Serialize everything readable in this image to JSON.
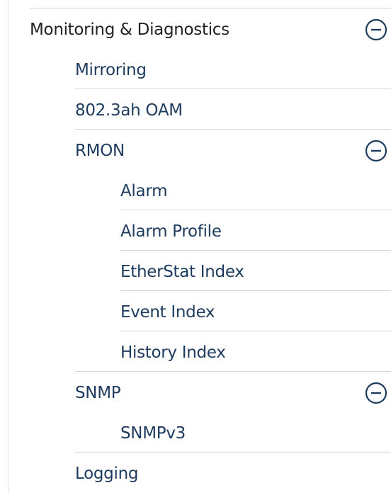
{
  "menu": {
    "section": {
      "label": "Monitoring & Diagnostics",
      "expanded": true,
      "toggle_icon": "collapse-minus-icon",
      "items": [
        {
          "label": "Mirroring"
        },
        {
          "label": "802.3ah OAM"
        },
        {
          "label": "RMON",
          "expanded": true,
          "toggle_icon": "collapse-minus-icon",
          "children": [
            {
              "label": "Alarm"
            },
            {
              "label": "Alarm Profile"
            },
            {
              "label": "EtherStat Index"
            },
            {
              "label": "Event Index"
            },
            {
              "label": "History Index"
            }
          ]
        },
        {
          "label": "SNMP",
          "expanded": true,
          "toggle_icon": "collapse-minus-icon",
          "children": [
            {
              "label": "SNMPv3"
            }
          ]
        },
        {
          "label": "Logging"
        }
      ]
    }
  },
  "colors": {
    "section_text": "#222222",
    "item_text": "#1d3b5e",
    "icon": "#1d3b5e",
    "divider": "#d4d4d4"
  }
}
